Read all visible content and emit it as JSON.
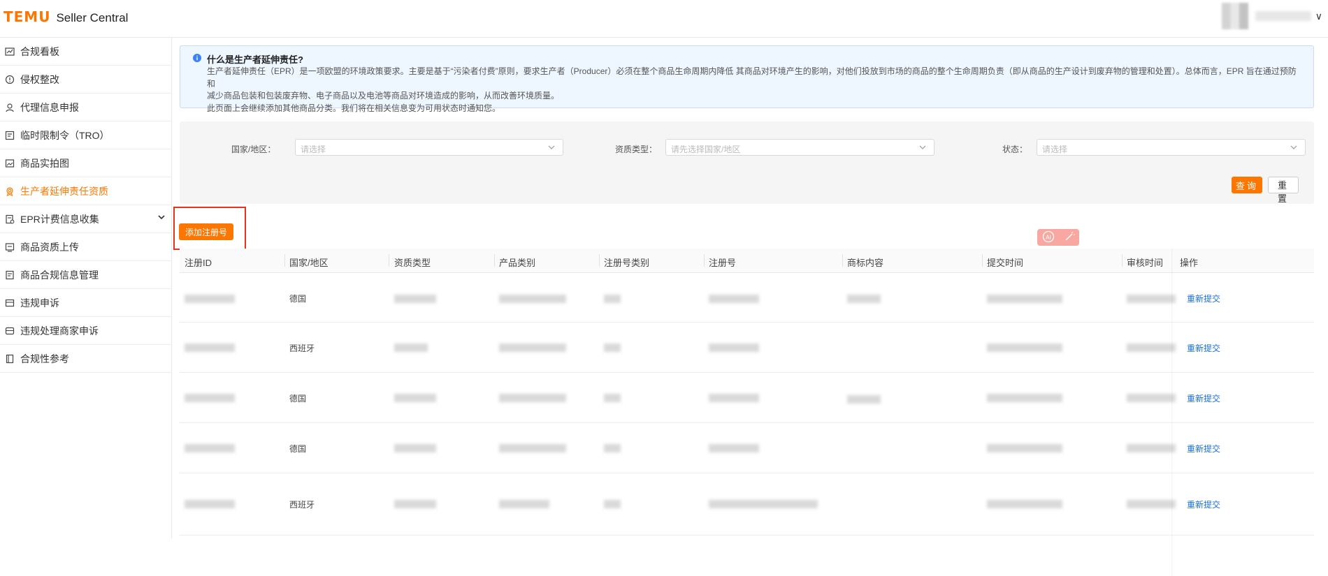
{
  "header": {
    "brand": "TEMU",
    "product": "Seller Central",
    "user_chevron": "∨"
  },
  "sidebar": {
    "items": [
      {
        "label": "合规看板",
        "icon": "chart-line-icon",
        "active": false
      },
      {
        "label": "侵权整改",
        "icon": "shield-icon",
        "active": false
      },
      {
        "label": "代理信息申报",
        "icon": "user-icon",
        "active": false
      },
      {
        "label": "临时限制令（TRO）",
        "icon": "restriction-icon",
        "active": false
      },
      {
        "label": "商品实拍图",
        "icon": "image-icon",
        "active": false
      },
      {
        "label": "生产者延伸责任资质",
        "icon": "badge-icon",
        "active": true
      },
      {
        "label": "EPR计费信息收集",
        "icon": "billing-icon",
        "active": false,
        "expandable": true
      },
      {
        "label": "商品资质上传",
        "icon": "upload-icon",
        "active": false
      },
      {
        "label": "商品合规信息管理",
        "icon": "document-icon",
        "active": false
      },
      {
        "label": "违规申诉",
        "icon": "appeal-icon",
        "active": false
      },
      {
        "label": "违规处理商家申诉",
        "icon": "merchant-appeal-icon",
        "active": false
      },
      {
        "label": "合规性参考",
        "icon": "book-icon",
        "active": false
      }
    ]
  },
  "notice": {
    "title": "什么是生产者延伸责任?",
    "line1": "生产者延伸责任（EPR）是一项欧盟的环境政策要求。主要是基于“污染者付费”原则，要求生产者（Producer）必须在整个商品生命周期内降低 其商品对环境产生的影响，对他们投放到市场的商品的整个生命周期负责（即从商品的生产设计到废弃物的管理和处置）。总体而言，EPR 旨在通过预防和",
    "line2": "减少商品包装和包装废弃物、电子商品以及电池等商品对环境造成的影响，从而改善环境质量。",
    "line3": "此页面上会继续添加其他商品分类。我们将在相关信息变为可用状态时通知您。"
  },
  "filters": {
    "country_label": "国家/地区：",
    "country_placeholder": "请选择",
    "qual_label": "资质类型：",
    "qual_placeholder": "请先选择国家/地区",
    "status_label": "状态：",
    "status_placeholder": "请选择",
    "query_button": "查询",
    "reset_button": "重置"
  },
  "add_button": "添加注册号",
  "table": {
    "columns": [
      "注册ID",
      "国家/地区",
      "资质类型",
      "产品类别",
      "注册号类别",
      "注册号",
      "商标内容",
      "提交时间",
      "审核时间",
      "操作"
    ],
    "rows": [
      {
        "country": "德国",
        "action": "重新提交",
        "has_trademark": true
      },
      {
        "country": "西班牙",
        "action": "重新提交",
        "has_trademark": false
      },
      {
        "country": "德国",
        "action": "重新提交",
        "has_trademark": true
      },
      {
        "country": "德国",
        "action": "重新提交",
        "has_trademark": false
      },
      {
        "country": "西班牙",
        "action": "重新提交",
        "has_trademark": false
      }
    ]
  }
}
